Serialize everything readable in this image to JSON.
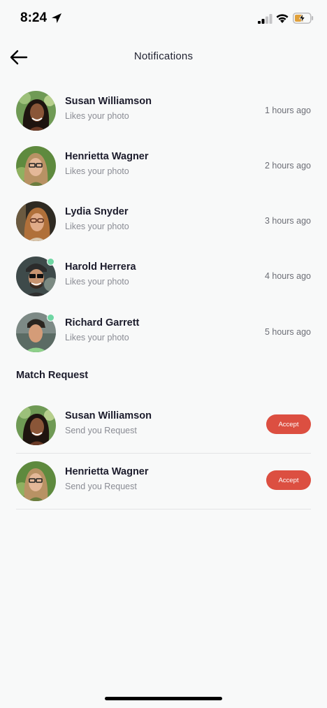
{
  "status_bar": {
    "time": "8:24"
  },
  "header": {
    "title": "Notifications"
  },
  "notifications": [
    {
      "name": "Susan Williamson",
      "message": "Likes your photo",
      "time": "1  hours ago",
      "online": false
    },
    {
      "name": "Henrietta Wagner",
      "message": "Likes your photo",
      "time": "2  hours ago",
      "online": false
    },
    {
      "name": "Lydia Snyder",
      "message": "Likes your photo",
      "time": "3  hours ago",
      "online": false
    },
    {
      "name": "Harold Herrera",
      "message": "Likes your photo",
      "time": "4  hours ago",
      "online": true
    },
    {
      "name": "Richard Garrett",
      "message": "Likes your photo",
      "time": "5  hours ago",
      "online": true
    }
  ],
  "match_request": {
    "title": "Match Request",
    "items": [
      {
        "name": "Susan Williamson",
        "message": "Send you Request",
        "button": "Accept"
      },
      {
        "name": "Henrietta Wagner",
        "message": "Send you Request",
        "button": "Accept"
      }
    ]
  },
  "colors": {
    "accent": "#dc4f41",
    "online": "#6fd6a3",
    "background": "#f8f9f9"
  },
  "icons": [
    "location-arrow-icon",
    "signal-icon",
    "wifi-icon",
    "battery-charging-icon",
    "back-arrow-icon"
  ]
}
